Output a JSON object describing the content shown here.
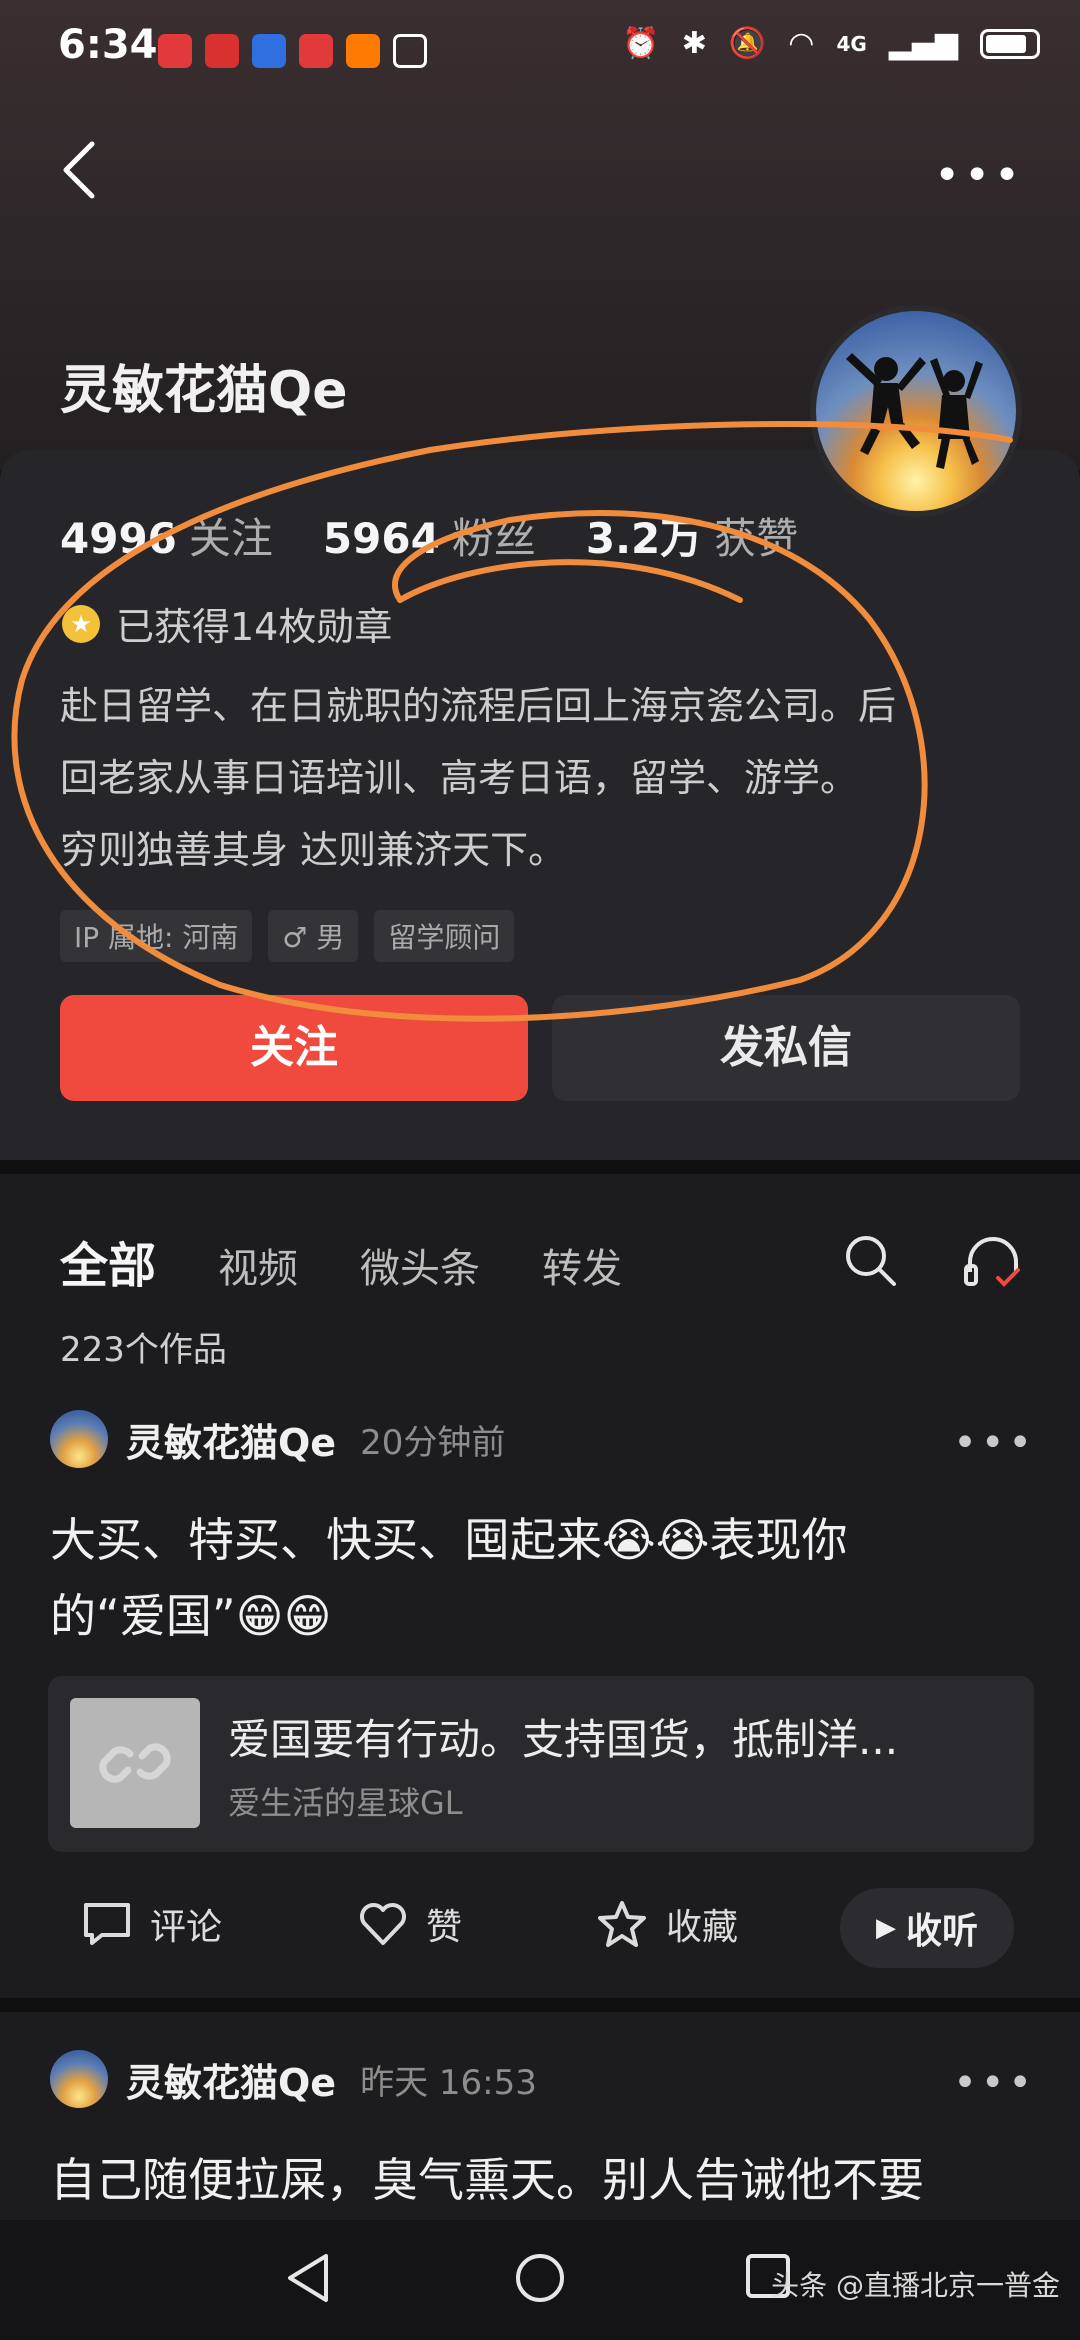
{
  "status_bar": {
    "time": "6:34",
    "network": "4G"
  },
  "profile": {
    "name": "灵敏花猫Qe",
    "stats": [
      {
        "value": "4996",
        "label": "关注"
      },
      {
        "value": "5964",
        "label": "粉丝"
      },
      {
        "value": "3.2万",
        "label": "获赞"
      }
    ],
    "medal_text": "已获得14枚勋章",
    "bio_lines": [
      "赴日留学、在日就职的流程后回上海京瓷公司。后",
      "回老家从事日语培训、高考日语，留学、游学。",
      "穷则独善其身 达则兼济天下。"
    ],
    "tags": [
      "IP 属地: 河南",
      "♂ 男",
      "留学顾问"
    ],
    "follow_label": "关注",
    "message_label": "发私信"
  },
  "tabs": [
    "全部",
    "视频",
    "微头条",
    "转发"
  ],
  "works_count": "223个作品",
  "posts": [
    {
      "author": "灵敏花猫Qe",
      "time": "20分钟前",
      "text_line1": "大买、特买、快买、囤起来😭😭表现你",
      "text_line2": "的“爱国”😁😁",
      "link_title": "爱国要有行动。支持国货，抵制洋...",
      "link_source": "爱生活的星球GL"
    },
    {
      "author": "灵敏花猫Qe",
      "time": "昨天  16:53",
      "text_line1": "自己随便拉屎，臭气熏天。别人告诫他不要"
    }
  ],
  "actions": {
    "comment": "评论",
    "like": "赞",
    "favorite": "收藏",
    "listen": "收听"
  },
  "watermark": "头条 @直播北京一普金",
  "colors": {
    "accent": "#f04a3e",
    "annotation": "#f08c3c"
  }
}
